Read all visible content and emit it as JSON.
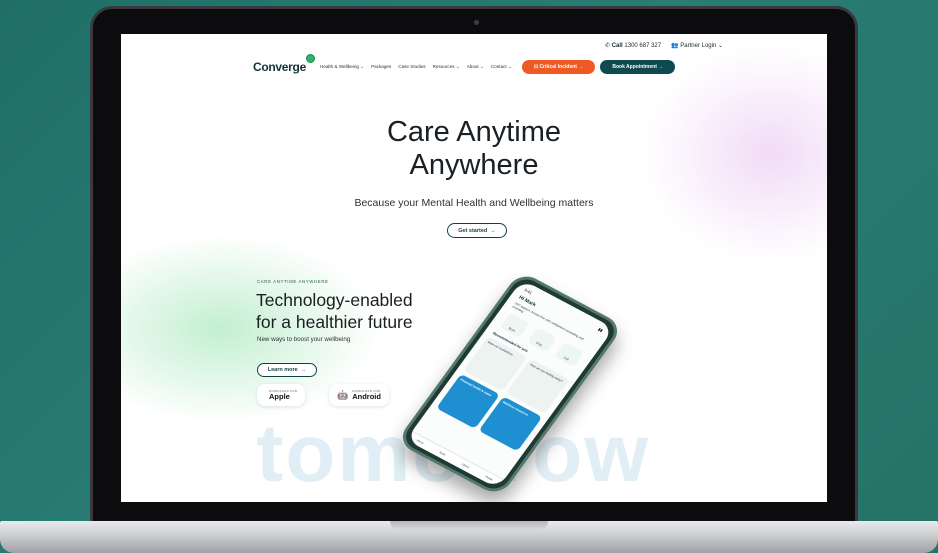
{
  "header": {
    "call_label": "Call",
    "phone": "1300 687 327",
    "partner_login": "Partner Login",
    "logo_text": "Converge",
    "nav": [
      "Health & Wellbeing",
      "Packages",
      "Case Studies",
      "Resources",
      "About",
      "Contact"
    ],
    "critical_incident": "Critical Incident",
    "book_appointment": "Book Appointment"
  },
  "hero": {
    "title_line1": "Care Anytime",
    "title_line2": "Anywhere",
    "subtitle": "Because your Mental Health and Wellbeing matters",
    "get_started": "Get started"
  },
  "feature": {
    "eyebrow": "CARE ANYTIME ANYWHERE",
    "headline_line1": "Technology-enabled",
    "headline_line2": "for a healthier future",
    "subline": "New ways to boost your wellbeing",
    "learn_more": "Learn more",
    "apple_small": "DOWNLOAD FOR",
    "apple_big": "Apple",
    "android_small": "DOWNLOAD FOR",
    "android_big": "Android",
    "watermark": "tomorrow"
  },
  "phone": {
    "time": "9:41",
    "greeting": "Hi Mark",
    "intro": "24/7 support. Access free and confidential counselling and coaching",
    "icons": [
      "Book",
      "Chat",
      "Call"
    ],
    "section_title": "Recommended for you",
    "cards": [
      "Meet our counsellors",
      "How are you feeling today?",
      "Financial health & super",
      "Wellness resources"
    ],
    "bottom_nav": [
      "Home",
      "Book",
      "Library",
      "Profile"
    ]
  },
  "colors": {
    "accent_orange": "#ef5a24",
    "brand_teal": "#0f4a50",
    "background": "#247367"
  },
  "icons": {
    "phone": "phone-icon",
    "partner": "users-icon",
    "arrow": "arrow-right-icon",
    "apple": "apple-icon",
    "android": "android-icon"
  }
}
